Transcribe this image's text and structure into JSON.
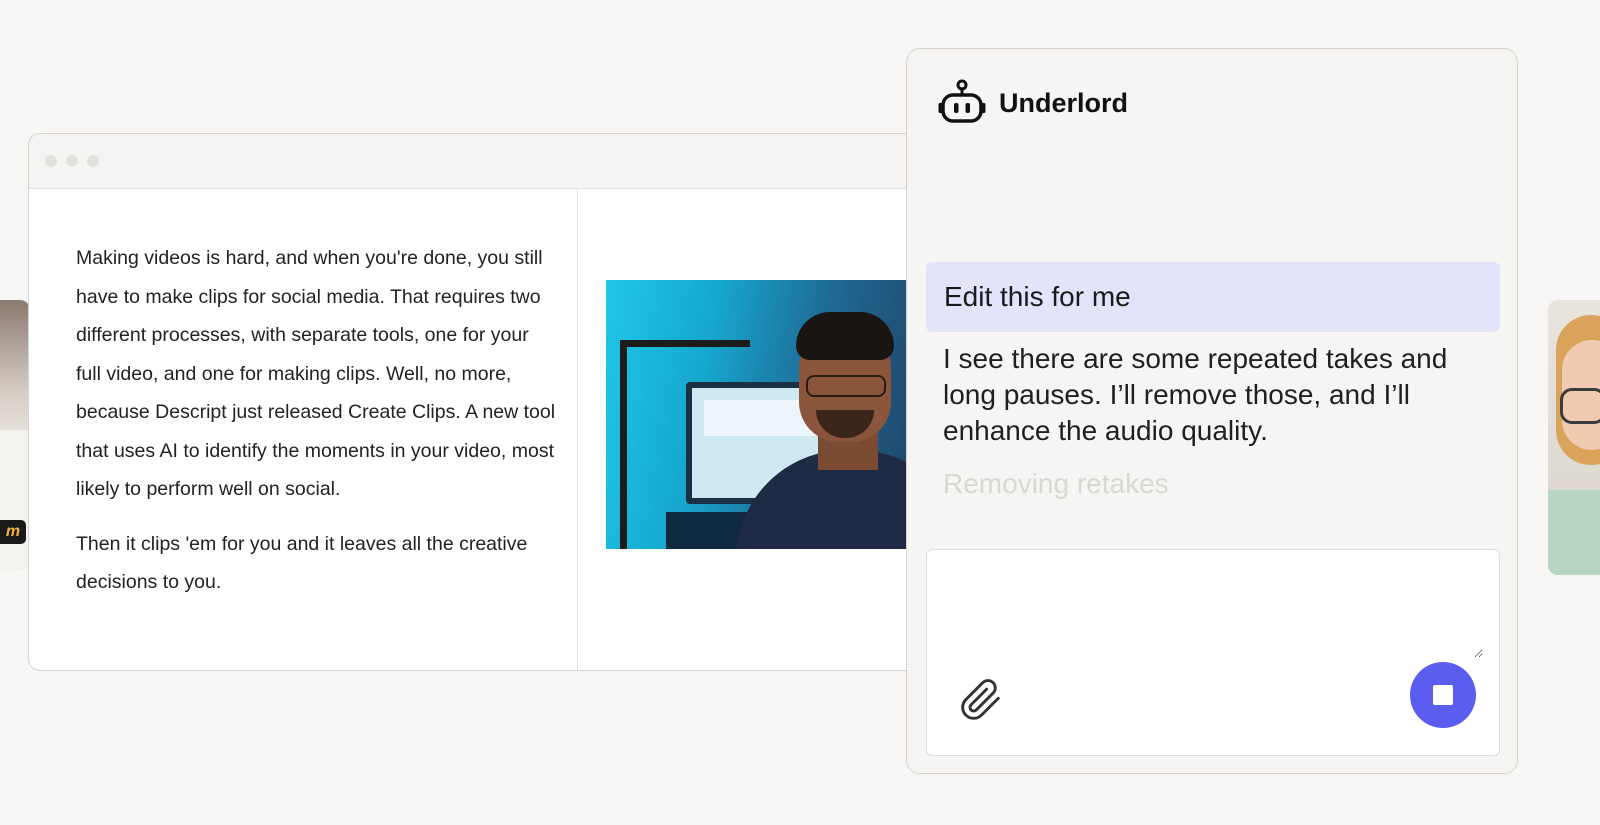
{
  "editor": {
    "script_paragraphs": [
      "Making videos is hard, and when you're done, you still have to make clips for social media. That requires two different processes, with separate tools, one for your full video, and one for making clips. Well, no more, because Descript just released Create Clips. A new tool that uses AI to identify the moments in your video, most likely to perform well on social.",
      "Then it clips 'em for you and it leaves all the creative decisions to you."
    ]
  },
  "assistant": {
    "name": "Underlord",
    "icon": "robot-icon",
    "user_message": "Edit this for me",
    "response": "I see there are some repeated takes and long pauses. I’ll remove those, and I’ll enhance the audio quality.",
    "status": "Removing retakes",
    "composer": {
      "placeholder": "",
      "attach_icon": "paperclip-icon",
      "stop_icon": "stop-icon"
    }
  },
  "colors": {
    "background": "#f7f6f4",
    "accent": "#5b5cf0",
    "user_bubble": "#e3e4fb"
  }
}
